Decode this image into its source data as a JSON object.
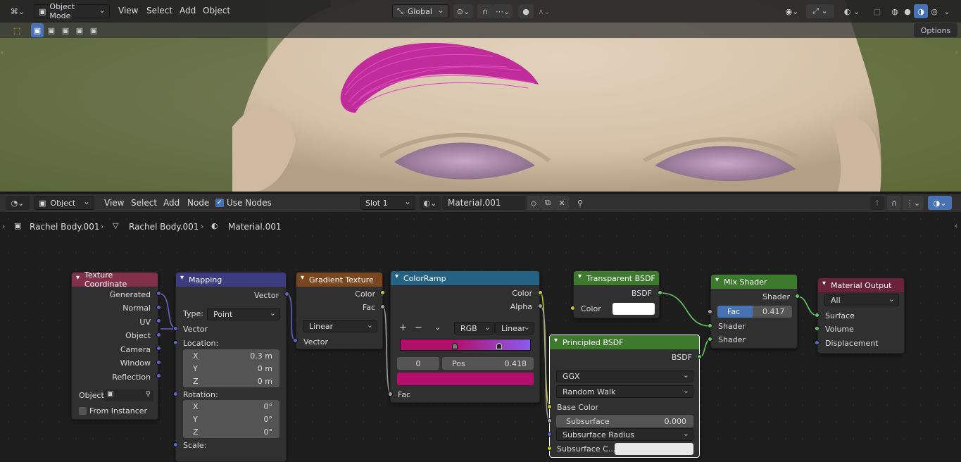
{
  "viewport_header": {
    "mode": "Object Mode",
    "menus": [
      "View",
      "Select",
      "Add",
      "Object"
    ],
    "orientation": "Global",
    "options_label": "Options"
  },
  "node_header": {
    "object_type": "Object",
    "menus": [
      "View",
      "Select",
      "Add",
      "Node"
    ],
    "use_nodes_label": "Use Nodes",
    "slot": "Slot 1",
    "material": "Material.001"
  },
  "breadcrumb": {
    "object": "Rachel Body.001",
    "mesh": "Rachel Body.001",
    "material": "Material.001"
  },
  "nodes": {
    "texcoord": {
      "title": "Texture Coordinate",
      "outputs": [
        "Generated",
        "Normal",
        "UV",
        "Object",
        "Camera",
        "Window",
        "Reflection"
      ],
      "object_label": "Object:",
      "from_instancer": "From Instancer"
    },
    "mapping": {
      "title": "Mapping",
      "out": "Vector",
      "type_label": "Type:",
      "type_value": "Point",
      "vector_in": "Vector",
      "location": "Location:",
      "loc": [
        {
          "a": "X",
          "v": "0.3 m"
        },
        {
          "a": "Y",
          "v": "0 m"
        },
        {
          "a": "Z",
          "v": "0 m"
        }
      ],
      "rotation": "Rotation:",
      "rot": [
        {
          "a": "X",
          "v": "0°"
        },
        {
          "a": "Y",
          "v": "0°"
        },
        {
          "a": "Z",
          "v": "0°"
        }
      ],
      "scale": "Scale:"
    },
    "gradient": {
      "title": "Gradient Texture",
      "out_color": "Color",
      "out_fac": "Fac",
      "type": "Linear",
      "vector_in": "Vector"
    },
    "colorramp": {
      "title": "ColorRamp",
      "out_color": "Color",
      "out_alpha": "Alpha",
      "plus": "+",
      "minus": "−",
      "mode": "RGB",
      "interp": "Linear",
      "index": "0",
      "pos_label": "Pos",
      "pos_value": "0.418",
      "fac_in": "Fac",
      "color_start": "#b0106a",
      "color_end": "#8a5cf0",
      "active_color": "#b50d6e"
    },
    "transparent": {
      "title": "Transparent BSDF",
      "out": "BSDF",
      "color_label": "Color"
    },
    "mix": {
      "title": "Mix Shader",
      "out": "Shader",
      "fac_label": "Fac",
      "fac_value": "0.417",
      "fac_fraction": 0.417,
      "in1": "Shader",
      "in2": "Shader"
    },
    "output": {
      "title": "Material Output",
      "target": "All",
      "surface": "Surface",
      "volume": "Volume",
      "displacement": "Displacement"
    },
    "principled": {
      "title": "Principled BSDF",
      "out": "BSDF",
      "distribution": "GGX",
      "sss_method": "Random Walk",
      "base_color": "Base Color",
      "subsurface": "Subsurface",
      "subsurface_value": "0.000",
      "subsurface_radius": "Subsurface Radius",
      "subsurface_color": "Subsurface C..."
    }
  },
  "colors": {
    "texcoord_header": "#83314a",
    "mapping_header": "#3c3c83",
    "gradient_header": "#79461d",
    "colorramp_header": "#246283",
    "shader_header": "#3d7a2e",
    "output_header": "#69223a"
  }
}
